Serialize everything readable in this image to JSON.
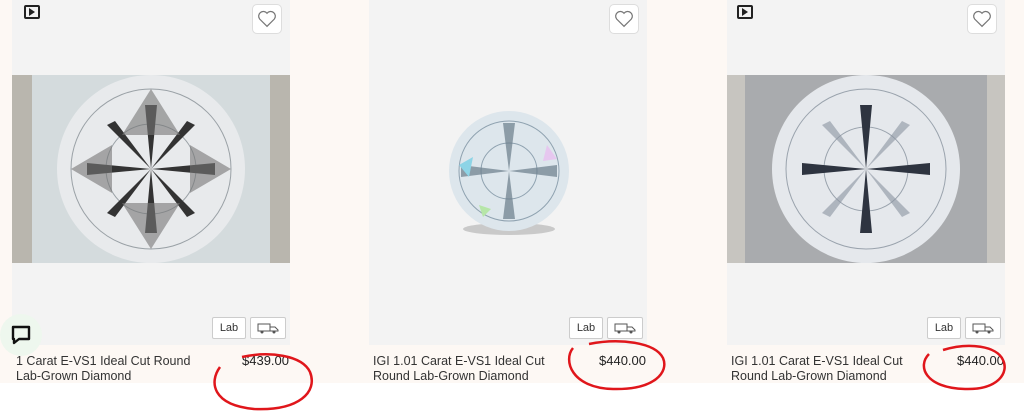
{
  "products": [
    {
      "badge": "Lab",
      "title_prefix": "",
      "title": "1 Carat E-VS1 Ideal Cut Round Lab-Grown Diamond",
      "price": "$439.00"
    },
    {
      "badge": "Lab",
      "title": "IGI 1.01 Carat E-VS1 Ideal Cut Round Lab-Grown Diamond",
      "price": "$440.00"
    },
    {
      "badge": "Lab",
      "title": "IGI 1.01 Carat E-VS1 Ideal Cut Round Lab-Grown Diamond",
      "price": "$440.00"
    }
  ],
  "icons": {
    "video": "video-play-icon",
    "favorite": "heart-icon",
    "shipping": "truck-icon",
    "chat": "chat-icon"
  },
  "colors": {
    "annotation": "#e0161b",
    "card_bg": "#f3f3f3"
  }
}
